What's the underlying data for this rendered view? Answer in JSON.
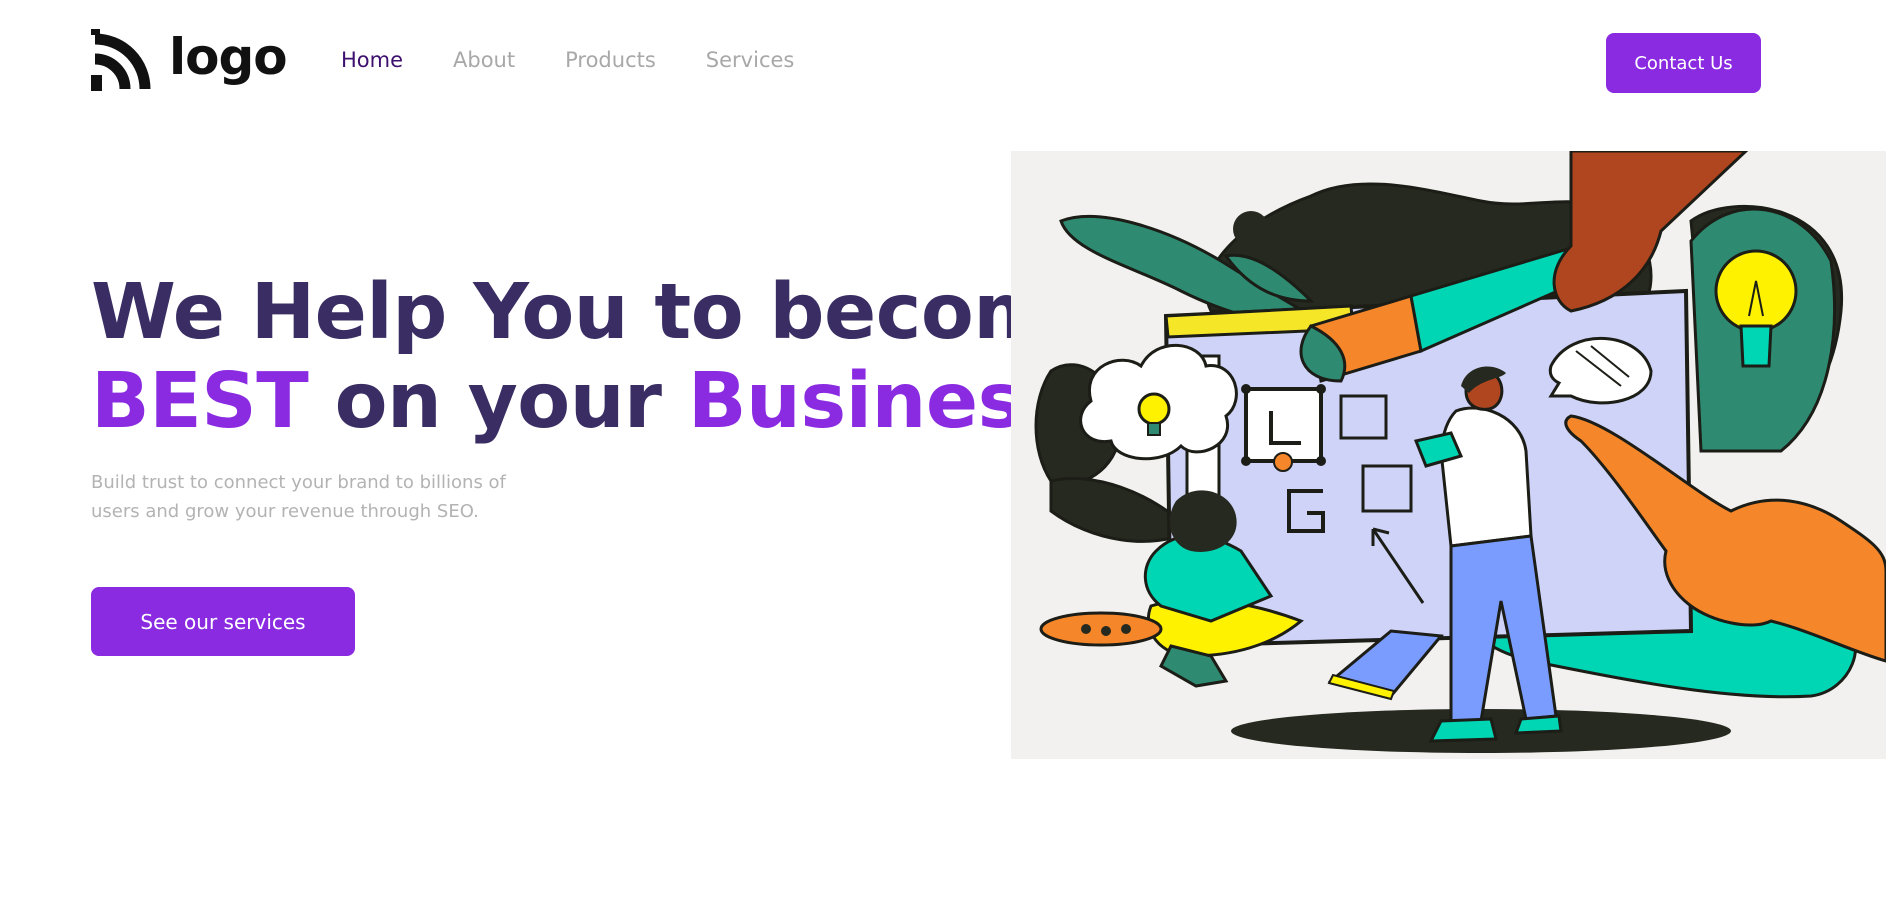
{
  "brand": {
    "logo_text": "logo",
    "logo_icon": "rss-arcs-logo-icon",
    "accent_color": "#8a2be2",
    "heading_color": "#3a2d63"
  },
  "nav": {
    "items": [
      {
        "label": "Home",
        "active": true
      },
      {
        "label": "About",
        "active": false
      },
      {
        "label": "Products",
        "active": false
      },
      {
        "label": "Services",
        "active": false
      }
    ]
  },
  "header": {
    "contact_label": "Contact Us"
  },
  "hero": {
    "title_line1": "We Help You to become",
    "title_word_best": "BEST",
    "title_mid": " on your ",
    "title_word_business": "Business",
    "subtitle": "Build trust to connect your brand to billions of users and grow your revenue through SEO.",
    "cta_label": "See our services"
  },
  "illustration": {
    "subject": "team-design-collaboration-illustration"
  }
}
